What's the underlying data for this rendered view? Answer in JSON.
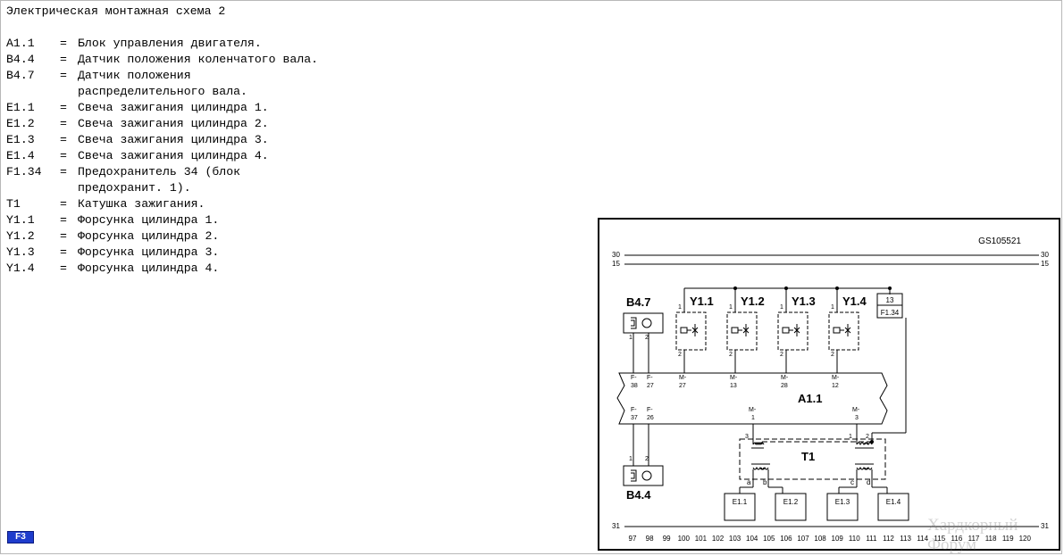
{
  "legend": {
    "title": "Электрическая монтажная схема 2",
    "items": [
      {
        "code": "A1.1",
        "lines": [
          "Блок управления двигателя."
        ]
      },
      {
        "code": "B4.4",
        "lines": [
          "Датчик положения коленчатого вала."
        ]
      },
      {
        "code": "B4.7",
        "lines": [
          "Датчик положения",
          "распределительного вала."
        ]
      },
      {
        "code": "E1.1",
        "lines": [
          "Свеча зажигания цилиндра 1."
        ]
      },
      {
        "code": "E1.2",
        "lines": [
          "Свеча зажигания цилиндра 2."
        ]
      },
      {
        "code": "E1.3",
        "lines": [
          "Свеча зажигания цилиндра 3."
        ]
      },
      {
        "code": "E1.4",
        "lines": [
          "Свеча зажигания цилиндра 4."
        ]
      },
      {
        "code": "F1.34",
        "lines": [
          "Предохранитель 34 (блок",
          "предохранит. 1)."
        ]
      },
      {
        "code": "T1",
        "lines": [
          "Катушка зажигания."
        ]
      },
      {
        "code": "Y1.1",
        "lines": [
          "Форсунка цилиндра 1."
        ]
      },
      {
        "code": "Y1.2",
        "lines": [
          "Форсунка цилиндра 2."
        ]
      },
      {
        "code": "Y1.3",
        "lines": [
          "Форсунка цилиндра 3."
        ]
      },
      {
        "code": "Y1.4",
        "lines": [
          "Форсунка цилиндра 4."
        ]
      }
    ],
    "separator": "="
  },
  "diagram": {
    "drawing_id": "GS105521",
    "rail_30": "30",
    "rail_15": "15",
    "rail_31": "31",
    "injectors": [
      {
        "label": "Y1.1",
        "pin_top": "1",
        "pin_bottom": "2",
        "ecu_prefix": "M-",
        "ecu_pin": "27"
      },
      {
        "label": "Y1.2",
        "pin_top": "1",
        "pin_bottom": "2",
        "ecu_prefix": "M-",
        "ecu_pin": "13"
      },
      {
        "label": "Y1.3",
        "pin_top": "1",
        "pin_bottom": "2",
        "ecu_prefix": "M-",
        "ecu_pin": "28"
      },
      {
        "label": "Y1.4",
        "pin_top": "1",
        "pin_bottom": "2",
        "ecu_prefix": "M-",
        "ecu_pin": "12"
      }
    ],
    "fuse": {
      "number": "13",
      "label": "F1.34"
    },
    "cam_sensor": {
      "label": "B4.7",
      "pin1": "1",
      "pin2": "2",
      "ecu_top": [
        [
          "F-",
          "38"
        ],
        [
          "F-",
          "27"
        ]
      ]
    },
    "crank_sensor": {
      "label": "B4.4",
      "pin1": "1",
      "pin2": "2",
      "ecu_bottom": [
        [
          "F-",
          "37"
        ],
        [
          "F-",
          "26"
        ]
      ]
    },
    "ecu": {
      "label": "A1.1",
      "coil_pins": [
        [
          "M-",
          "1"
        ],
        [
          "M-",
          "3"
        ]
      ]
    },
    "coil": {
      "label": "T1",
      "top_pins": [
        "3",
        "1",
        "2"
      ],
      "bottom_pins": [
        "a",
        "b",
        "c",
        "d"
      ]
    },
    "plugs": [
      "E1.1",
      "E1.2",
      "E1.3",
      "E1.4"
    ],
    "grid_numbers": [
      "97",
      "98",
      "99",
      "100",
      "101",
      "102",
      "103",
      "104",
      "105",
      "106",
      "107",
      "108",
      "109",
      "110",
      "111",
      "112",
      "113",
      "114",
      "115",
      "116",
      "117",
      "118",
      "119",
      "120"
    ]
  },
  "footer": {
    "f3_label": "F3",
    "watermark": "Хардкорный Форум"
  }
}
